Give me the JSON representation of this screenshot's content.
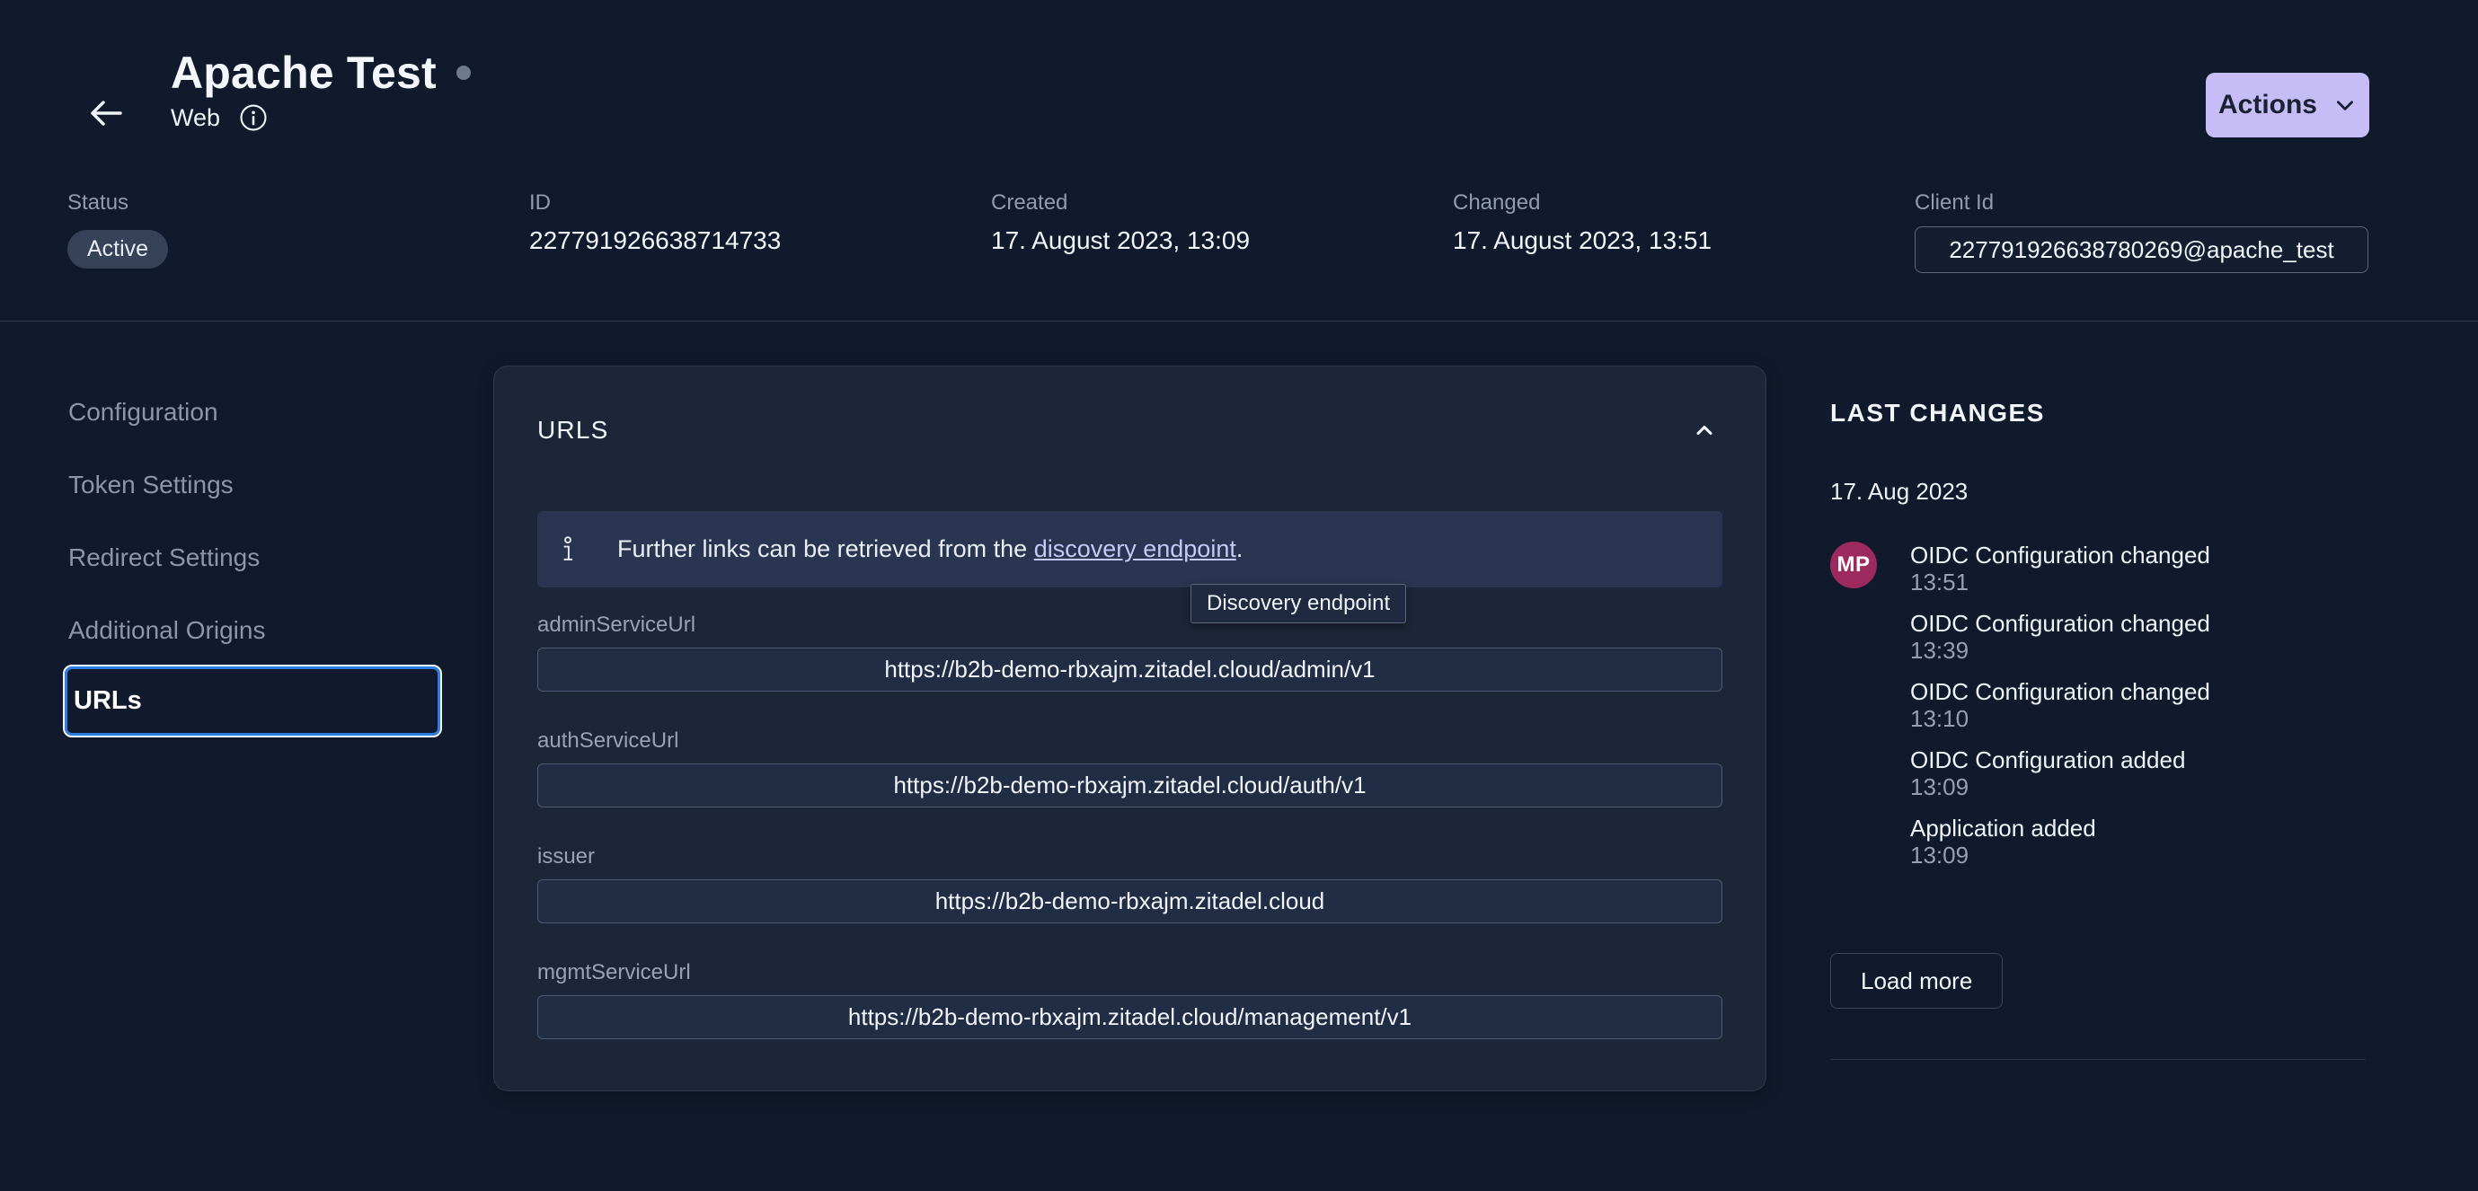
{
  "header": {
    "title": "Apache Test",
    "subtitle": "Web",
    "actions_label": "Actions",
    "meta": {
      "status_label": "Status",
      "status_value": "Active",
      "id_label": "ID",
      "id_value": "227791926638714733",
      "created_label": "Created",
      "created_value": "17. August 2023, 13:09",
      "changed_label": "Changed",
      "changed_value": "17. August 2023, 13:51",
      "client_id_label": "Client Id",
      "client_id_value": "227791926638780269@apache_test"
    }
  },
  "sidebar": {
    "items": [
      {
        "label": "Configuration"
      },
      {
        "label": "Token Settings"
      },
      {
        "label": "Redirect Settings"
      },
      {
        "label": "Additional Origins"
      },
      {
        "label": "URLs"
      }
    ]
  },
  "urls_card": {
    "title": "URLS",
    "info_text_prefix": "Further links can be retrieved from the ",
    "info_link_text": "discovery endpoint",
    "info_text_suffix": ".",
    "tooltip": "Discovery endpoint",
    "fields": [
      {
        "label": "adminServiceUrl",
        "value": "https://b2b-demo-rbxajm.zitadel.cloud/admin/v1"
      },
      {
        "label": "authServiceUrl",
        "value": "https://b2b-demo-rbxajm.zitadel.cloud/auth/v1"
      },
      {
        "label": "issuer",
        "value": "https://b2b-demo-rbxajm.zitadel.cloud"
      },
      {
        "label": "mgmtServiceUrl",
        "value": "https://b2b-demo-rbxajm.zitadel.cloud/management/v1"
      }
    ]
  },
  "changes_panel": {
    "title": "LAST CHANGES",
    "date": "17. Aug 2023",
    "avatar_initials": "MP",
    "events": [
      {
        "title": "OIDC Configuration changed",
        "time": "13:51"
      },
      {
        "title": "OIDC Configuration changed",
        "time": "13:39"
      },
      {
        "title": "OIDC Configuration changed",
        "time": "13:10"
      },
      {
        "title": "OIDC Configuration added",
        "time": "13:09"
      },
      {
        "title": "Application added",
        "time": "13:09"
      }
    ],
    "load_more_label": "Load more"
  },
  "colors": {
    "page_bg": "#101a2c",
    "card_bg": "#1d2639",
    "banner_bg": "#2a3552",
    "accent_button_bg": "#c7bdf6",
    "active_item_border": "#2e7de0",
    "avatar_bg": "#9c2a5e",
    "link": "#c4caf6"
  }
}
